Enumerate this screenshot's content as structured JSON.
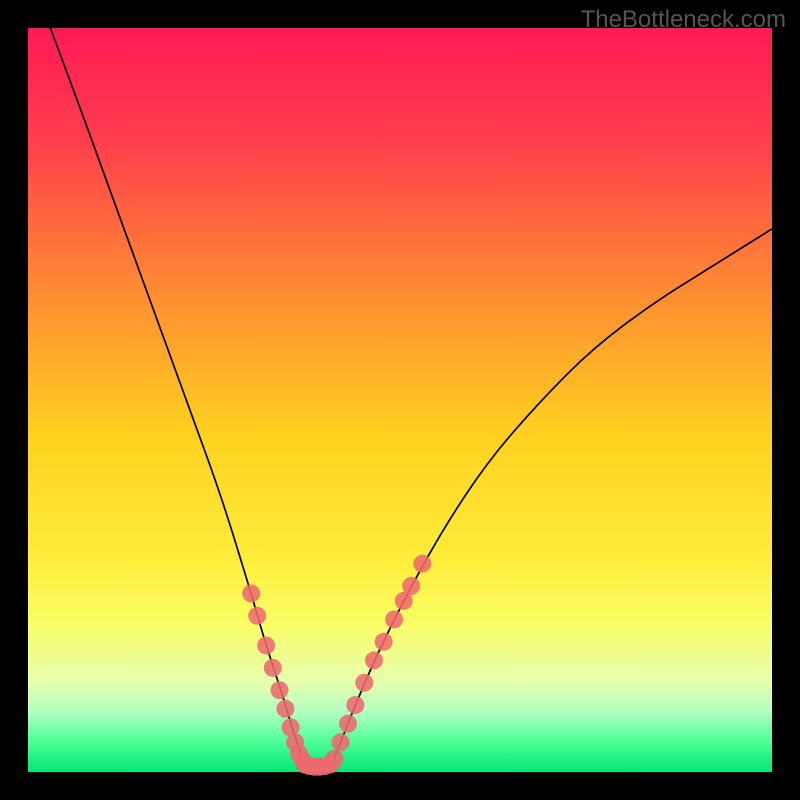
{
  "watermark": "TheBottleneck.com",
  "chart_data": {
    "type": "line",
    "title": "",
    "xlabel": "",
    "ylabel": "",
    "xlim": [
      0,
      100
    ],
    "ylim": [
      0,
      100
    ],
    "grid": false,
    "background_gradient": {
      "stops": [
        {
          "offset": 0.0,
          "color": "#ff1a55"
        },
        {
          "offset": 0.15,
          "color": "#ff3e4d"
        },
        {
          "offset": 0.35,
          "color": "#ff8a33"
        },
        {
          "offset": 0.55,
          "color": "#ffd21f"
        },
        {
          "offset": 0.72,
          "color": "#ffee3d"
        },
        {
          "offset": 0.8,
          "color": "#faff66"
        },
        {
          "offset": 0.88,
          "color": "#e6ffb0"
        },
        {
          "offset": 0.92,
          "color": "#b0ffc0"
        },
        {
          "offset": 0.96,
          "color": "#4dff95"
        },
        {
          "offset": 1.0,
          "color": "#00e676"
        }
      ]
    },
    "series": [
      {
        "name": "left-branch",
        "type": "curve",
        "color": "#000000",
        "stroke_width": 1.7,
        "x": [
          3,
          6,
          10,
          14,
          18,
          22,
          26,
          30,
          32,
          34,
          35.5,
          36.5,
          37.2
        ],
        "y": [
          100,
          92,
          81,
          70,
          59,
          48,
          37,
          24,
          17,
          11,
          6,
          3,
          1
        ]
      },
      {
        "name": "right-branch",
        "type": "curve",
        "color": "#000000",
        "stroke_width": 1.7,
        "x": [
          40.8,
          42,
          44,
          47,
          51,
          56,
          62,
          69,
          76,
          84,
          92,
          100
        ],
        "y": [
          1,
          4,
          9,
          16,
          24,
          33,
          42,
          50,
          57,
          63,
          68,
          73
        ]
      },
      {
        "name": "flat-bottom",
        "type": "line",
        "color": "#000000",
        "stroke_width": 1.7,
        "x": [
          37.2,
          40.8
        ],
        "y": [
          1,
          1
        ]
      },
      {
        "name": "left-beads",
        "type": "scatter",
        "color": "#ed6a6e",
        "marker_size": 9,
        "x": [
          30.0,
          30.8,
          32.0,
          32.9,
          33.8,
          34.6,
          35.3,
          35.9,
          36.4,
          36.9,
          37.2
        ],
        "y": [
          24.0,
          21.0,
          17.0,
          14.0,
          11.0,
          8.5,
          6.0,
          4.0,
          2.5,
          1.6,
          1.0
        ]
      },
      {
        "name": "bottom-beads",
        "type": "scatter",
        "color": "#ed6a6e",
        "marker_size": 9,
        "x": [
          37.8,
          38.5,
          39.2,
          39.9,
          40.6
        ],
        "y": [
          0.8,
          0.7,
          0.7,
          0.8,
          1.0
        ]
      },
      {
        "name": "right-beads",
        "type": "scatter",
        "color": "#ed6a6e",
        "marker_size": 9,
        "x": [
          41.2,
          42.0,
          43.0,
          44.0,
          45.2,
          46.5,
          47.8,
          49.2,
          50.5,
          51.5,
          53.0
        ],
        "y": [
          1.8,
          4.0,
          6.5,
          9.0,
          12.0,
          15.0,
          17.5,
          20.5,
          23.0,
          25.0,
          28.0
        ]
      }
    ]
  },
  "frame": {
    "outer_color": "#000000",
    "outer_thickness": 28,
    "inner_left": 28,
    "inner_top": 28,
    "inner_right": 772,
    "inner_bottom": 772
  }
}
